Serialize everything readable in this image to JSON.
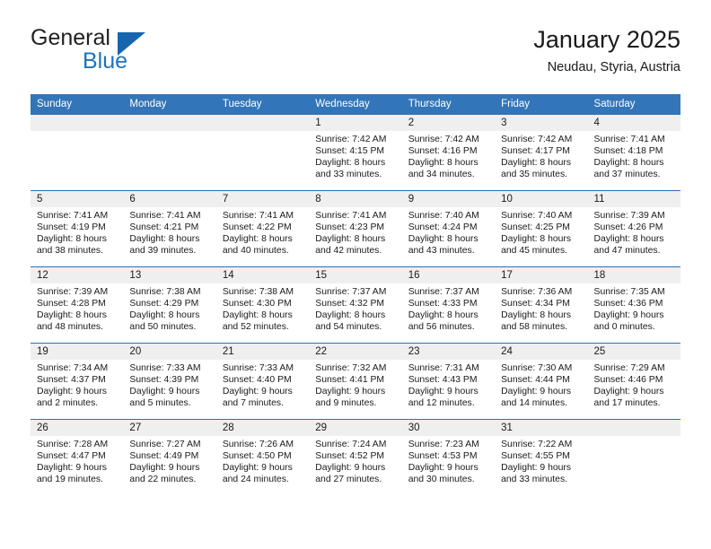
{
  "brand": {
    "name_part1": "General",
    "name_part2": "Blue",
    "triangle_color": "#1665ad",
    "blue_color": "#1d74bb"
  },
  "header": {
    "title": "January 2025",
    "subtitle": "Neudau, Styria, Austria",
    "header_bg_color": "#3275b8",
    "row_divider_color": "#2f6fb0",
    "daynum_band_color": "#efefef"
  },
  "weekday_headers": [
    "Sunday",
    "Monday",
    "Tuesday",
    "Wednesday",
    "Thursday",
    "Friday",
    "Saturday"
  ],
  "weeks": [
    [
      {
        "day": "",
        "empty": true,
        "sunrise": "",
        "sunset": "",
        "daylight_line1": "",
        "daylight_line2": ""
      },
      {
        "day": "",
        "empty": true,
        "sunrise": "",
        "sunset": "",
        "daylight_line1": "",
        "daylight_line2": ""
      },
      {
        "day": "",
        "empty": true,
        "sunrise": "",
        "sunset": "",
        "daylight_line1": "",
        "daylight_line2": ""
      },
      {
        "day": "1",
        "empty": false,
        "sunrise": "Sunrise: 7:42 AM",
        "sunset": "Sunset: 4:15 PM",
        "daylight_line1": "Daylight: 8 hours",
        "daylight_line2": "and 33 minutes."
      },
      {
        "day": "2",
        "empty": false,
        "sunrise": "Sunrise: 7:42 AM",
        "sunset": "Sunset: 4:16 PM",
        "daylight_line1": "Daylight: 8 hours",
        "daylight_line2": "and 34 minutes."
      },
      {
        "day": "3",
        "empty": false,
        "sunrise": "Sunrise: 7:42 AM",
        "sunset": "Sunset: 4:17 PM",
        "daylight_line1": "Daylight: 8 hours",
        "daylight_line2": "and 35 minutes."
      },
      {
        "day": "4",
        "empty": false,
        "sunrise": "Sunrise: 7:41 AM",
        "sunset": "Sunset: 4:18 PM",
        "daylight_line1": "Daylight: 8 hours",
        "daylight_line2": "and 37 minutes."
      }
    ],
    [
      {
        "day": "5",
        "empty": false,
        "sunrise": "Sunrise: 7:41 AM",
        "sunset": "Sunset: 4:19 PM",
        "daylight_line1": "Daylight: 8 hours",
        "daylight_line2": "and 38 minutes."
      },
      {
        "day": "6",
        "empty": false,
        "sunrise": "Sunrise: 7:41 AM",
        "sunset": "Sunset: 4:21 PM",
        "daylight_line1": "Daylight: 8 hours",
        "daylight_line2": "and 39 minutes."
      },
      {
        "day": "7",
        "empty": false,
        "sunrise": "Sunrise: 7:41 AM",
        "sunset": "Sunset: 4:22 PM",
        "daylight_line1": "Daylight: 8 hours",
        "daylight_line2": "and 40 minutes."
      },
      {
        "day": "8",
        "empty": false,
        "sunrise": "Sunrise: 7:41 AM",
        "sunset": "Sunset: 4:23 PM",
        "daylight_line1": "Daylight: 8 hours",
        "daylight_line2": "and 42 minutes."
      },
      {
        "day": "9",
        "empty": false,
        "sunrise": "Sunrise: 7:40 AM",
        "sunset": "Sunset: 4:24 PM",
        "daylight_line1": "Daylight: 8 hours",
        "daylight_line2": "and 43 minutes."
      },
      {
        "day": "10",
        "empty": false,
        "sunrise": "Sunrise: 7:40 AM",
        "sunset": "Sunset: 4:25 PM",
        "daylight_line1": "Daylight: 8 hours",
        "daylight_line2": "and 45 minutes."
      },
      {
        "day": "11",
        "empty": false,
        "sunrise": "Sunrise: 7:39 AM",
        "sunset": "Sunset: 4:26 PM",
        "daylight_line1": "Daylight: 8 hours",
        "daylight_line2": "and 47 minutes."
      }
    ],
    [
      {
        "day": "12",
        "empty": false,
        "sunrise": "Sunrise: 7:39 AM",
        "sunset": "Sunset: 4:28 PM",
        "daylight_line1": "Daylight: 8 hours",
        "daylight_line2": "and 48 minutes."
      },
      {
        "day": "13",
        "empty": false,
        "sunrise": "Sunrise: 7:38 AM",
        "sunset": "Sunset: 4:29 PM",
        "daylight_line1": "Daylight: 8 hours",
        "daylight_line2": "and 50 minutes."
      },
      {
        "day": "14",
        "empty": false,
        "sunrise": "Sunrise: 7:38 AM",
        "sunset": "Sunset: 4:30 PM",
        "daylight_line1": "Daylight: 8 hours",
        "daylight_line2": "and 52 minutes."
      },
      {
        "day": "15",
        "empty": false,
        "sunrise": "Sunrise: 7:37 AM",
        "sunset": "Sunset: 4:32 PM",
        "daylight_line1": "Daylight: 8 hours",
        "daylight_line2": "and 54 minutes."
      },
      {
        "day": "16",
        "empty": false,
        "sunrise": "Sunrise: 7:37 AM",
        "sunset": "Sunset: 4:33 PM",
        "daylight_line1": "Daylight: 8 hours",
        "daylight_line2": "and 56 minutes."
      },
      {
        "day": "17",
        "empty": false,
        "sunrise": "Sunrise: 7:36 AM",
        "sunset": "Sunset: 4:34 PM",
        "daylight_line1": "Daylight: 8 hours",
        "daylight_line2": "and 58 minutes."
      },
      {
        "day": "18",
        "empty": false,
        "sunrise": "Sunrise: 7:35 AM",
        "sunset": "Sunset: 4:36 PM",
        "daylight_line1": "Daylight: 9 hours",
        "daylight_line2": "and 0 minutes."
      }
    ],
    [
      {
        "day": "19",
        "empty": false,
        "sunrise": "Sunrise: 7:34 AM",
        "sunset": "Sunset: 4:37 PM",
        "daylight_line1": "Daylight: 9 hours",
        "daylight_line2": "and 2 minutes."
      },
      {
        "day": "20",
        "empty": false,
        "sunrise": "Sunrise: 7:33 AM",
        "sunset": "Sunset: 4:39 PM",
        "daylight_line1": "Daylight: 9 hours",
        "daylight_line2": "and 5 minutes."
      },
      {
        "day": "21",
        "empty": false,
        "sunrise": "Sunrise: 7:33 AM",
        "sunset": "Sunset: 4:40 PM",
        "daylight_line1": "Daylight: 9 hours",
        "daylight_line2": "and 7 minutes."
      },
      {
        "day": "22",
        "empty": false,
        "sunrise": "Sunrise: 7:32 AM",
        "sunset": "Sunset: 4:41 PM",
        "daylight_line1": "Daylight: 9 hours",
        "daylight_line2": "and 9 minutes."
      },
      {
        "day": "23",
        "empty": false,
        "sunrise": "Sunrise: 7:31 AM",
        "sunset": "Sunset: 4:43 PM",
        "daylight_line1": "Daylight: 9 hours",
        "daylight_line2": "and 12 minutes."
      },
      {
        "day": "24",
        "empty": false,
        "sunrise": "Sunrise: 7:30 AM",
        "sunset": "Sunset: 4:44 PM",
        "daylight_line1": "Daylight: 9 hours",
        "daylight_line2": "and 14 minutes."
      },
      {
        "day": "25",
        "empty": false,
        "sunrise": "Sunrise: 7:29 AM",
        "sunset": "Sunset: 4:46 PM",
        "daylight_line1": "Daylight: 9 hours",
        "daylight_line2": "and 17 minutes."
      }
    ],
    [
      {
        "day": "26",
        "empty": false,
        "sunrise": "Sunrise: 7:28 AM",
        "sunset": "Sunset: 4:47 PM",
        "daylight_line1": "Daylight: 9 hours",
        "daylight_line2": "and 19 minutes."
      },
      {
        "day": "27",
        "empty": false,
        "sunrise": "Sunrise: 7:27 AM",
        "sunset": "Sunset: 4:49 PM",
        "daylight_line1": "Daylight: 9 hours",
        "daylight_line2": "and 22 minutes."
      },
      {
        "day": "28",
        "empty": false,
        "sunrise": "Sunrise: 7:26 AM",
        "sunset": "Sunset: 4:50 PM",
        "daylight_line1": "Daylight: 9 hours",
        "daylight_line2": "and 24 minutes."
      },
      {
        "day": "29",
        "empty": false,
        "sunrise": "Sunrise: 7:24 AM",
        "sunset": "Sunset: 4:52 PM",
        "daylight_line1": "Daylight: 9 hours",
        "daylight_line2": "and 27 minutes."
      },
      {
        "day": "30",
        "empty": false,
        "sunrise": "Sunrise: 7:23 AM",
        "sunset": "Sunset: 4:53 PM",
        "daylight_line1": "Daylight: 9 hours",
        "daylight_line2": "and 30 minutes."
      },
      {
        "day": "31",
        "empty": false,
        "sunrise": "Sunrise: 7:22 AM",
        "sunset": "Sunset: 4:55 PM",
        "daylight_line1": "Daylight: 9 hours",
        "daylight_line2": "and 33 minutes."
      },
      {
        "day": "",
        "empty": true,
        "sunrise": "",
        "sunset": "",
        "daylight_line1": "",
        "daylight_line2": ""
      }
    ]
  ]
}
